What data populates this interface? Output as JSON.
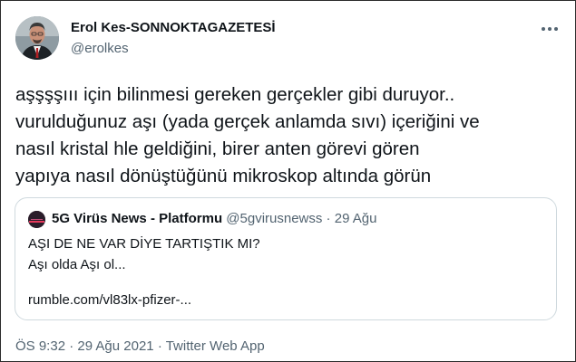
{
  "tweet": {
    "author_name": "Erol Kes-SONNOKTAGAZETESİ",
    "author_handle": "@erolkes",
    "avatar_icon": "profile-photo",
    "more_icon": "more-horizontal-icon",
    "text": "aşşşşııı için bilinmesi gereken gerçekler gibi duruyor..\nvurulduğunuz aşı (yada gerçek anlamda sıvı) içeriğini ve\nnasıl kristal hle geldiğini, birer anten görevi gören\nyapıya nasıl dönüştüğünü mikroskop altında görün",
    "time": "ÖS 9:32",
    "date": "29 Ağu 2021",
    "source": "Twitter Web App",
    "sep": " · "
  },
  "quoted": {
    "author_name": "5G Virüs News - Platformu",
    "author_handle": "@5gvirusnewss",
    "date": "29 Ağu",
    "sep": " · ",
    "line1": "AŞI DE NE VAR DİYE TARTIŞTIK MI?",
    "line2": "Aşı olda Aşı ol...",
    "link": "rumble.com/vl83lx-pfizer-..."
  },
  "colors": {
    "text": "#0f1419",
    "secondary": "#536471",
    "border": "#cfd9de"
  }
}
